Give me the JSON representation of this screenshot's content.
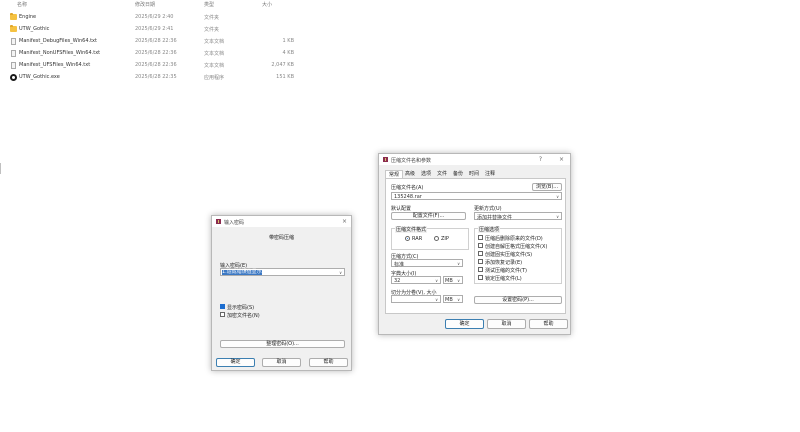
{
  "file_list": {
    "columns": {
      "name": "名称",
      "date": "修改日期",
      "type": "类型",
      "size": "大小"
    },
    "rows": [
      {
        "icon": "folder-icon",
        "name": "Engine",
        "date": "2025/6/29 2:40",
        "type": "文件夹",
        "size": ""
      },
      {
        "icon": "folder-icon",
        "name": "UTW_Gothic",
        "date": "2025/6/29 2:41",
        "type": "文件夹",
        "size": ""
      },
      {
        "icon": "text-file-icon",
        "name": "Manifest_DebugFiles_Win64.txt",
        "date": "2025/6/28 22:36",
        "type": "文本文档",
        "size": "1 KB"
      },
      {
        "icon": "text-file-icon",
        "name": "Manifest_NonUFSFiles_Win64.txt",
        "date": "2025/6/28 22:36",
        "type": "文本文档",
        "size": "4 KB"
      },
      {
        "icon": "text-file-icon",
        "name": "Manifest_UFSFiles_Win64.txt",
        "date": "2025/6/28 22:36",
        "type": "文本文档",
        "size": "2,047 KB"
      },
      {
        "icon": "app-icon",
        "name": "UTW_Gothic.exe",
        "date": "2025/6/28 22:35",
        "type": "应用程序",
        "size": "151 KB"
      }
    ]
  },
  "password_dialog": {
    "title": "输入密码",
    "heading": "带密码压缩",
    "enter_label": "输入密码(E)",
    "password_value": "1.造成错误值显示",
    "show_password_label": "显示密码(S)",
    "show_password_checked": true,
    "encrypt_names_label": "加密文件名(N)",
    "encrypt_names_checked": false,
    "organize_button": "整理密码(O)...",
    "ok": "确定",
    "cancel": "取消",
    "help": "帮助"
  },
  "archive_dialog": {
    "title": "压缩文件名和参数",
    "tabs": [
      "常规",
      "高级",
      "选项",
      "文件",
      "备份",
      "时间",
      "注释"
    ],
    "active_tab": "常规",
    "archive_name_label": "压缩文件名(A)",
    "archive_name_value": "135248.rar",
    "browse_button": "浏览(B)...",
    "default_profile_label": "默认配置",
    "profile_button": "配置文件(F)...",
    "update_mode_label": "更新方式(U)",
    "update_mode_value": "添加并替换文件",
    "format_group": "压缩文件格式",
    "format_rar": "RAR",
    "format_zip": "ZIP",
    "selected_format": "RAR",
    "method_label": "压缩方式(C)",
    "method_value": "标准",
    "dict_label": "字典大小(I)",
    "dict_value": "32",
    "dict_unit": "MB",
    "split_label": "切分为分卷(V), 大小",
    "split_value": "",
    "split_unit": "MB",
    "options_group": "压缩选项",
    "options": [
      {
        "label": "压缩后删除原来的文件(D)",
        "checked": false
      },
      {
        "label": "创建自解压格式压缩文件(X)",
        "checked": false
      },
      {
        "label": "创建固实压缩文件(S)",
        "checked": false
      },
      {
        "label": "添加恢复记录(E)",
        "checked": false
      },
      {
        "label": "测试压缩的文件(T)",
        "checked": false
      },
      {
        "label": "锁定压缩文件(L)",
        "checked": false
      }
    ],
    "set_password_button": "设置密码(P)...",
    "ok": "确定",
    "cancel": "取消",
    "help": "帮助"
  }
}
